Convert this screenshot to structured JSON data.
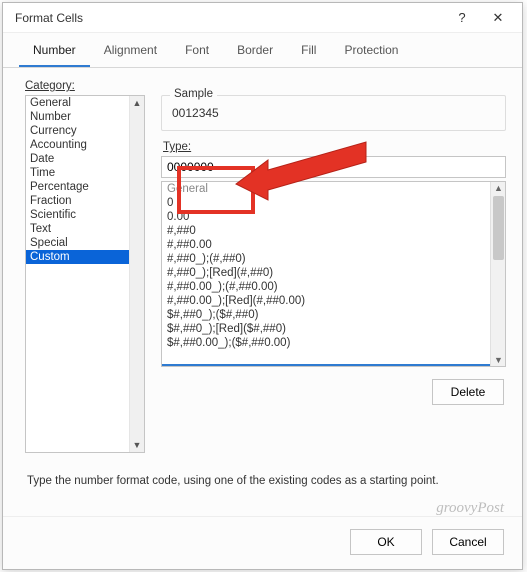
{
  "dialog": {
    "title": "Format Cells"
  },
  "tabs": [
    {
      "label": "Number",
      "active": true
    },
    {
      "label": "Alignment"
    },
    {
      "label": "Font"
    },
    {
      "label": "Border"
    },
    {
      "label": "Fill"
    },
    {
      "label": "Protection"
    }
  ],
  "categoryLabel": "Category:",
  "categories": [
    "General",
    "Number",
    "Currency",
    "Accounting",
    "Date",
    "Time",
    "Percentage",
    "Fraction",
    "Scientific",
    "Text",
    "Special",
    "Custom"
  ],
  "selectedCategoryIndex": 11,
  "sample": {
    "label": "Sample",
    "value": "0012345"
  },
  "typeLabel": "Type:",
  "typeValue": "0000000",
  "formats": [
    "General",
    "0",
    "0.00",
    "#,##0",
    "#,##0.00",
    "#,##0_);(#,##0)",
    "#,##0_);[Red](#,##0)",
    "#,##0.00_);(#,##0.00)",
    "#,##0.00_);[Red](#,##0.00)",
    "$#,##0_);($#,##0)",
    "$#,##0_);[Red]($#,##0)",
    "$#,##0.00_);($#,##0.00)"
  ],
  "deleteLabel": "Delete",
  "hint": "Type the number format code, using one of the existing codes as a starting point.",
  "okLabel": "OK",
  "cancelLabel": "Cancel",
  "watermark": "groovyPost"
}
